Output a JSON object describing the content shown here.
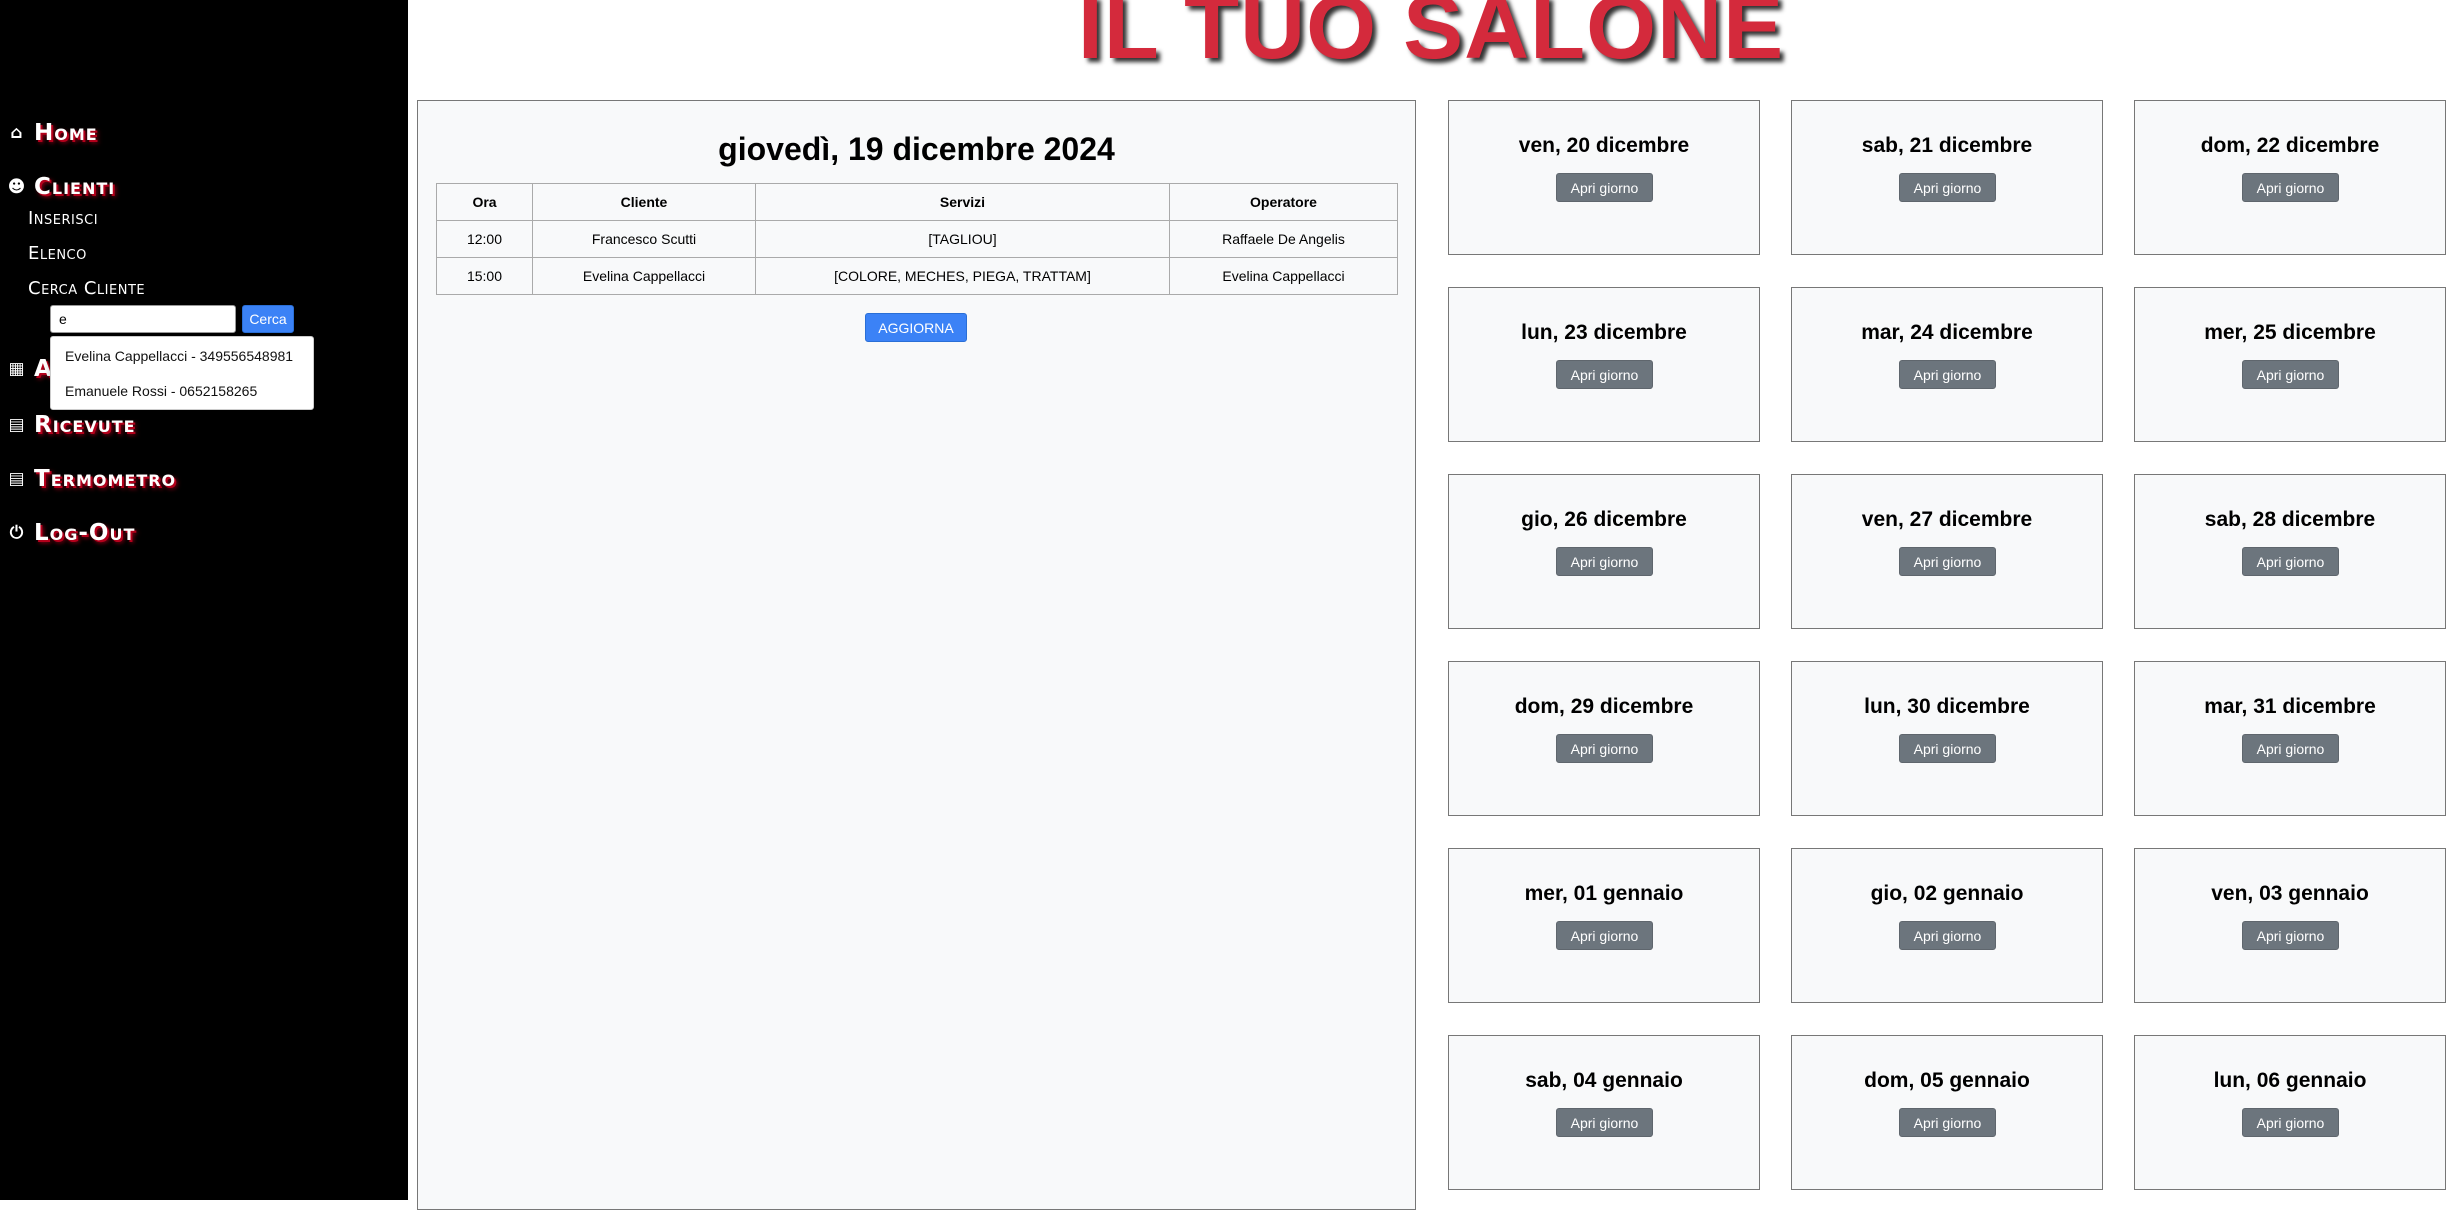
{
  "app": {
    "title": "IL TUO SALONE",
    "accent_color": "#d42a3c"
  },
  "sidebar": {
    "home": {
      "label": "Home",
      "icon": "home-icon"
    },
    "clienti": {
      "label": "Clienti",
      "icon": "users-icon",
      "items": [
        {
          "label": "Inserisci"
        },
        {
          "label": "Elenco"
        },
        {
          "label": "Cerca Cliente"
        }
      ]
    },
    "search": {
      "value": "e",
      "button_label": "Cerca",
      "suggestions": [
        "Evelina Cappellacci - 349556548981",
        "Emanuele Rossi - 0652158265"
      ]
    },
    "agenda": {
      "label": "Ap",
      "icon": "calendar-icon"
    },
    "ricevute": {
      "label": "Ricevute",
      "icon": "receipt-icon"
    },
    "termometro": {
      "label": "Termometro",
      "icon": "document-icon"
    },
    "logout": {
      "label": "Log-Out",
      "icon": "power-icon"
    }
  },
  "day": {
    "title": "giovedì, 19 dicembre 2024",
    "columns": [
      "Ora",
      "Cliente",
      "Servizi",
      "Operatore"
    ],
    "rows": [
      [
        "12:00",
        "Francesco Scutti",
        "[TAGLIOU]",
        "Raffaele De Angelis"
      ],
      [
        "15:00",
        "Evelina Cappellacci",
        "[COLORE, MECHES, PIEGA, TRATTAM]",
        "Evelina Cappellacci"
      ]
    ],
    "refresh_label": "AGGIORNA"
  },
  "days": [
    "ven, 20 dicembre",
    "sab, 21 dicembre",
    "dom, 22 dicembre",
    "lun, 23 dicembre",
    "mar, 24 dicembre",
    "mer, 25 dicembre",
    "gio, 26 dicembre",
    "ven, 27 dicembre",
    "sab, 28 dicembre",
    "dom, 29 dicembre",
    "lun, 30 dicembre",
    "mar, 31 dicembre",
    "mer, 01 gennaio",
    "gio, 02 gennaio",
    "ven, 03 gennaio",
    "sab, 04 gennaio",
    "dom, 05 gennaio",
    "lun, 06 gennaio"
  ],
  "open_day_label": "Apri giorno"
}
